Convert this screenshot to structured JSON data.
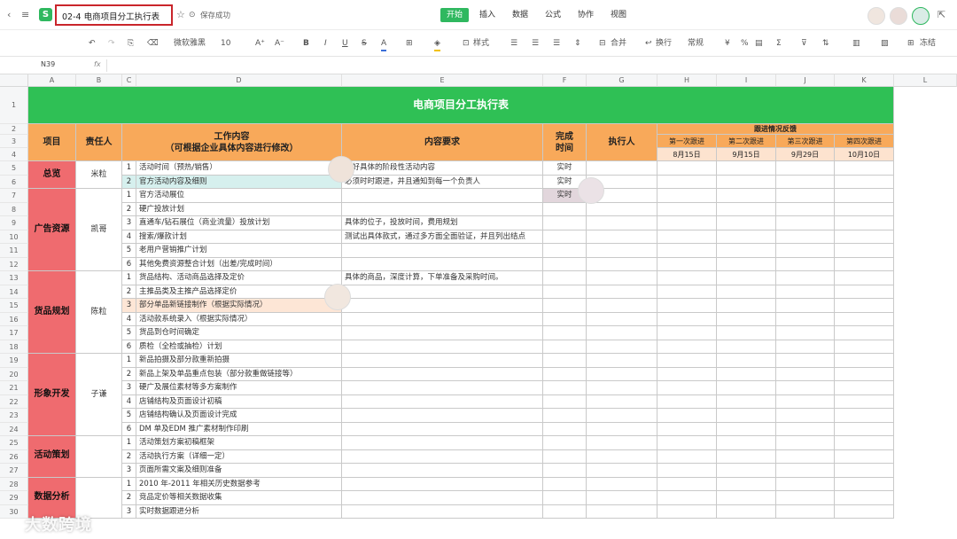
{
  "app": {
    "logo_letter": "S",
    "doc_title": "02-4 电商项目分工执行表",
    "save_status": "保存成功",
    "menus": [
      "开始",
      "插入",
      "数据",
      "公式",
      "协作",
      "视图"
    ]
  },
  "toolbar": {
    "font_name": "微软雅黑",
    "font_size": "10",
    "style_label": "样式",
    "merge_label": "合并",
    "wrap_label": "换行",
    "format_label": "常规",
    "freeze_label": "冻结"
  },
  "formula_bar": {
    "cell_ref": "N39",
    "fx": "fx",
    "value": ""
  },
  "columns": [
    "A",
    "B",
    "C",
    "D",
    "E",
    "F",
    "G",
    "H",
    "I",
    "J",
    "K",
    "L"
  ],
  "rows": [
    "1",
    "2",
    "3",
    "4",
    "5",
    "6",
    "7",
    "8",
    "9",
    "10",
    "11",
    "12",
    "13",
    "14",
    "15",
    "16",
    "17",
    "18",
    "19",
    "20",
    "21",
    "22",
    "23",
    "24",
    "25",
    "26",
    "27",
    "28",
    "29",
    "30"
  ],
  "sheet": {
    "title": "电商项目分工执行表",
    "headers": {
      "project": "项目",
      "owner": "责任人",
      "work": "工作内容\n（可根据企业具体内容进行修改）",
      "req": "内容要求",
      "done": "完成\n时间",
      "exec": "执行人",
      "followup": "跟进情况反馈",
      "rounds": [
        "第一次跟进",
        "第二次跟进",
        "第三次跟进",
        "第四次跟进"
      ],
      "dates": [
        "8月15日",
        "9月15日",
        "9月29日",
        "10月10日"
      ]
    },
    "groups": [
      {
        "project": "总览",
        "owner": "米粒",
        "rows": 2
      },
      {
        "project": "广告资源",
        "owner": "凯哥",
        "rows": 6
      },
      {
        "project": "货品规划",
        "owner": "陈粒",
        "rows": 6
      },
      {
        "project": "形象开发",
        "owner": "子谦",
        "rows": 6
      },
      {
        "project": "活动策划",
        "owner": "",
        "rows": 3
      },
      {
        "project": "数据分析",
        "owner": "",
        "rows": 3
      }
    ],
    "tasks": [
      {
        "n": "1",
        "t": "活动时间（预热/销售）",
        "r": "定好具体的阶段性活动内容",
        "f": "实时"
      },
      {
        "n": "2",
        "t": "官方活动内容及细则",
        "r": "必须时时跟进，并且通知到每一个负责人",
        "f": "实时"
      },
      {
        "n": "1",
        "t": "官方活动展位",
        "r": "",
        "f": "实时"
      },
      {
        "n": "2",
        "t": "硬广投放计划",
        "r": "",
        "f": ""
      },
      {
        "n": "3",
        "t": "直通车/钻石展位（商业流量）投放计划",
        "r": "具体的位子，投放时间，费用规划",
        "f": ""
      },
      {
        "n": "4",
        "t": "搜索/爆款计划",
        "r": "测试出具体款式，通过多方面全面验证，并且列出结点",
        "f": ""
      },
      {
        "n": "5",
        "t": "老用户营销推广计划",
        "r": "",
        "f": ""
      },
      {
        "n": "6",
        "t": "其他免费资源整合计划（出差/完成时间）",
        "r": "",
        "f": ""
      },
      {
        "n": "1",
        "t": "货品结构、活动商品选择及定价",
        "r": "具体的商品，深度计算，下单准备及采购时间。",
        "f": ""
      },
      {
        "n": "2",
        "t": "主推品类及主推产品选择定价",
        "r": "",
        "f": ""
      },
      {
        "n": "3",
        "t": "部分单品新链接制作（根据实际情况）",
        "r": "",
        "f": ""
      },
      {
        "n": "4",
        "t": "活动款系统录入（根据实际情况）",
        "r": "",
        "f": ""
      },
      {
        "n": "5",
        "t": "货品到仓时间确定",
        "r": "",
        "f": ""
      },
      {
        "n": "6",
        "t": "质检（全检或抽检）计划",
        "r": "",
        "f": ""
      },
      {
        "n": "1",
        "t": "新品拍摄及部分款重新拍摄",
        "r": "",
        "f": ""
      },
      {
        "n": "2",
        "t": "新品上架及单品重点包装（部分款重做链接等）",
        "r": "",
        "f": ""
      },
      {
        "n": "3",
        "t": "硬广及展位素材等多方案制作",
        "r": "",
        "f": ""
      },
      {
        "n": "4",
        "t": "店铺结构及页面设计初稿",
        "r": "",
        "f": ""
      },
      {
        "n": "5",
        "t": "店铺结构确认及页面设计完成",
        "r": "",
        "f": ""
      },
      {
        "n": "6",
        "t": "DM 单及EDM 推广素材制作印刷",
        "r": "",
        "f": ""
      },
      {
        "n": "1",
        "t": "活动策划方案初稿框架",
        "r": "",
        "f": ""
      },
      {
        "n": "2",
        "t": "活动执行方案（详细一定）",
        "r": "",
        "f": ""
      },
      {
        "n": "3",
        "t": "页面所需文案及细则准备",
        "r": "",
        "f": ""
      },
      {
        "n": "1",
        "t": "2010 年-2011 年相关历史数据参考",
        "r": "",
        "f": ""
      },
      {
        "n": "2",
        "t": "竞品定价等相关数据收集",
        "r": "",
        "f": ""
      },
      {
        "n": "3",
        "t": "实时数据跟进分析",
        "r": "",
        "f": ""
      }
    ]
  },
  "watermark": "大数跨境",
  "colors": {
    "green": "#2fc055",
    "orange": "#f8a95a",
    "red": "#ef6b6f",
    "highlight_blue": "#d6f0ee",
    "highlight_orange": "#fde6d6",
    "highlight_gray": "#e2d6dc"
  }
}
